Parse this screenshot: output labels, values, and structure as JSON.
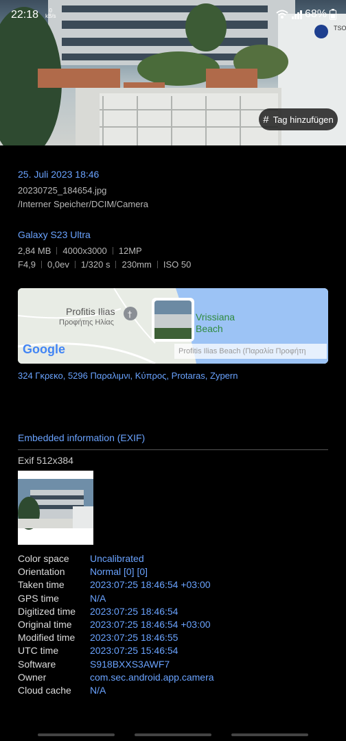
{
  "status": {
    "time": "22:18",
    "net_speed": "0\nkB/s",
    "battery": "68%"
  },
  "photo": {
    "tag_button": "Tag hinzufügen",
    "sign": "TSO"
  },
  "details": {
    "date": "25. Juli 2023 18:46",
    "filename": "20230725_184654.jpg",
    "path": "/Interner Speicher/DCIM/Camera",
    "device": "Galaxy S23 Ultra",
    "specs_row1": [
      "2,84 MB",
      "4000x3000",
      "12MP"
    ],
    "specs_row2": [
      "F4,9",
      "0,0ev",
      "1/320 s",
      "230mm",
      "ISO 50"
    ]
  },
  "map": {
    "place1": "Profitis Ilias",
    "place1_greek": "Προφήτης Ηλίας",
    "place2_line1": "Vrissiana",
    "place2_line2": "Beach",
    "banner": "Profitis Ilias Beach (Παραλία Προφήτη",
    "logo": "Google"
  },
  "address": "324 Γκρεκο, 5296 Παραλιμνι, Κύπρος, Protaras, Zypern",
  "exif": {
    "title": "Embedded information (EXIF)",
    "size": "Exif 512x384",
    "rows": [
      {
        "key": "Color space",
        "value": "Uncalibrated"
      },
      {
        "key": "Orientation",
        "value": "Normal [0] [0]"
      },
      {
        "key": "Taken time",
        "value": "2023:07:25 18:46:54 +03:00"
      },
      {
        "key": "GPS time",
        "value": "N/A"
      },
      {
        "key": "Digitized time",
        "value": "2023:07:25 18:46:54"
      },
      {
        "key": "Original time",
        "value": "2023:07:25 18:46:54 +03:00"
      },
      {
        "key": "Modified time",
        "value": "2023:07:25 18:46:55"
      },
      {
        "key": "UTC time",
        "value": "2023:07:25 15:46:54"
      },
      {
        "key": "Software",
        "value": "S918BXXS3AWF7"
      },
      {
        "key": "Owner",
        "value": "com.sec.android.app.camera"
      },
      {
        "key": "Cloud cache",
        "value": "N/A"
      }
    ]
  },
  "colors": {
    "accent": "#6aa3ff",
    "background": "#000000",
    "label": "#dddddd"
  }
}
